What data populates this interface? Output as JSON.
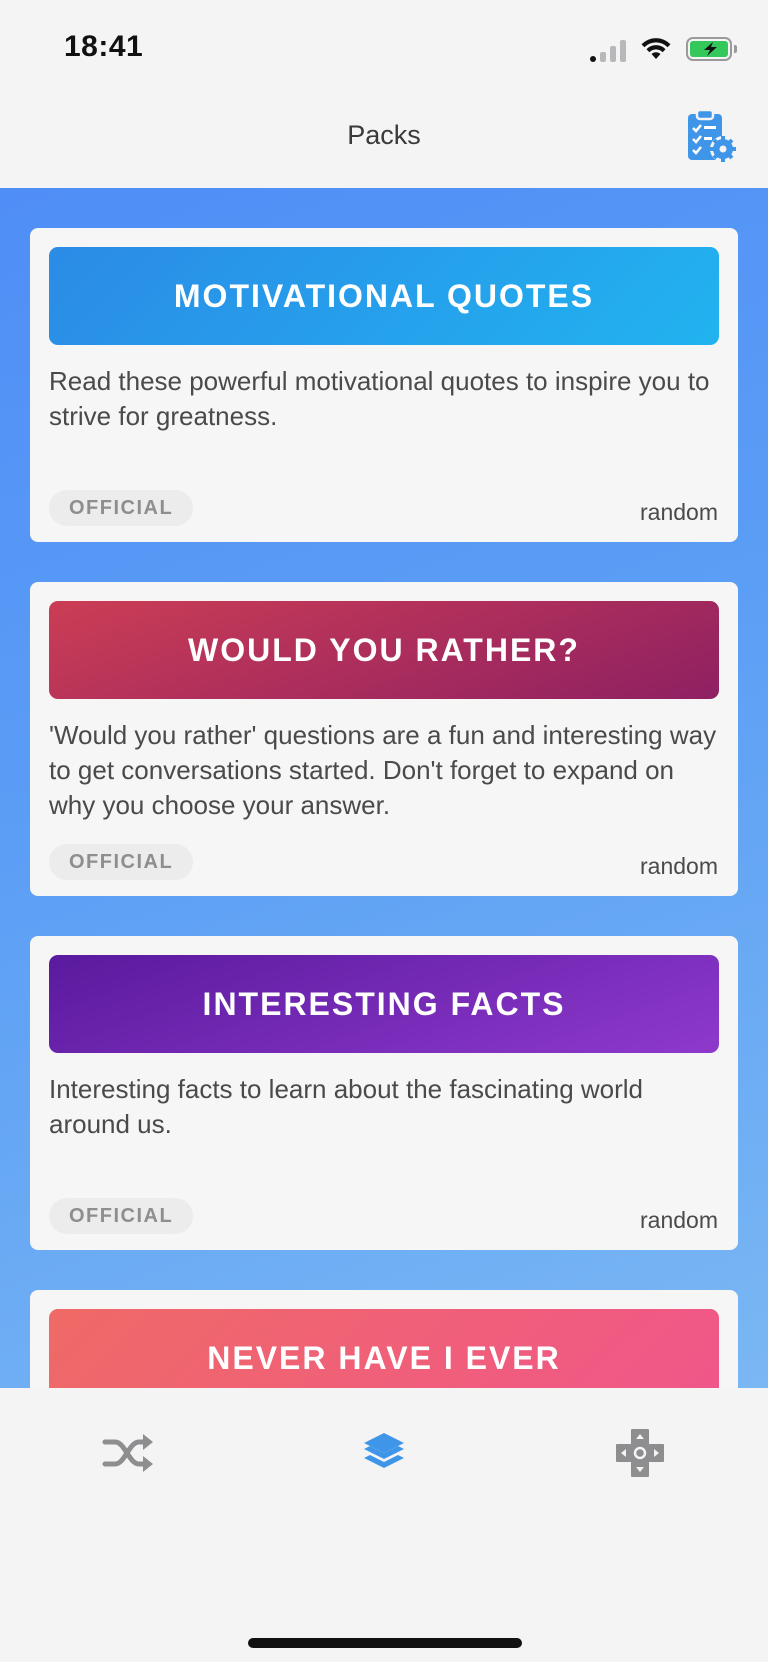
{
  "status_bar": {
    "time": "18:41"
  },
  "header": {
    "title": "Packs",
    "action_icon": "clipboard-settings-icon"
  },
  "colors": {
    "accent": "#3f96e8",
    "gradient_top": "#4f8ef6",
    "gradient_bottom": "#7ab7f3"
  },
  "packs": [
    {
      "title": "MOTIVATIONAL QUOTES",
      "description": "Read these powerful motivational quotes to inspire you to strive for greatness.",
      "badge": "OFFICIAL",
      "order": "random",
      "colors": [
        "#2b8be6",
        "#21b3f0"
      ]
    },
    {
      "title": "WOULD YOU RATHER?",
      "description": "'Would you rather' questions are a fun and interesting way to get conversations started. Don't forget to expand on why you choose your answer.",
      "badge": "OFFICIAL",
      "order": "random",
      "colors": [
        "#cc3d55",
        "#8e2062"
      ]
    },
    {
      "title": "INTERESTING FACTS",
      "description": "Interesting facts to learn about the fascinating world around us.",
      "badge": "OFFICIAL",
      "order": "random",
      "colors": [
        "#5a1a9e",
        "#8e39cc"
      ]
    },
    {
      "title": "NEVER HAVE I EVER",
      "colors": [
        "#ef6a66",
        "#f0568a"
      ]
    }
  ],
  "tab_bar": {
    "tabs": [
      {
        "name": "shuffle",
        "icon": "shuffle-icon",
        "active": false
      },
      {
        "name": "packs",
        "icon": "layers-icon",
        "active": true
      },
      {
        "name": "controller",
        "icon": "gamepad-icon",
        "active": false
      }
    ]
  }
}
